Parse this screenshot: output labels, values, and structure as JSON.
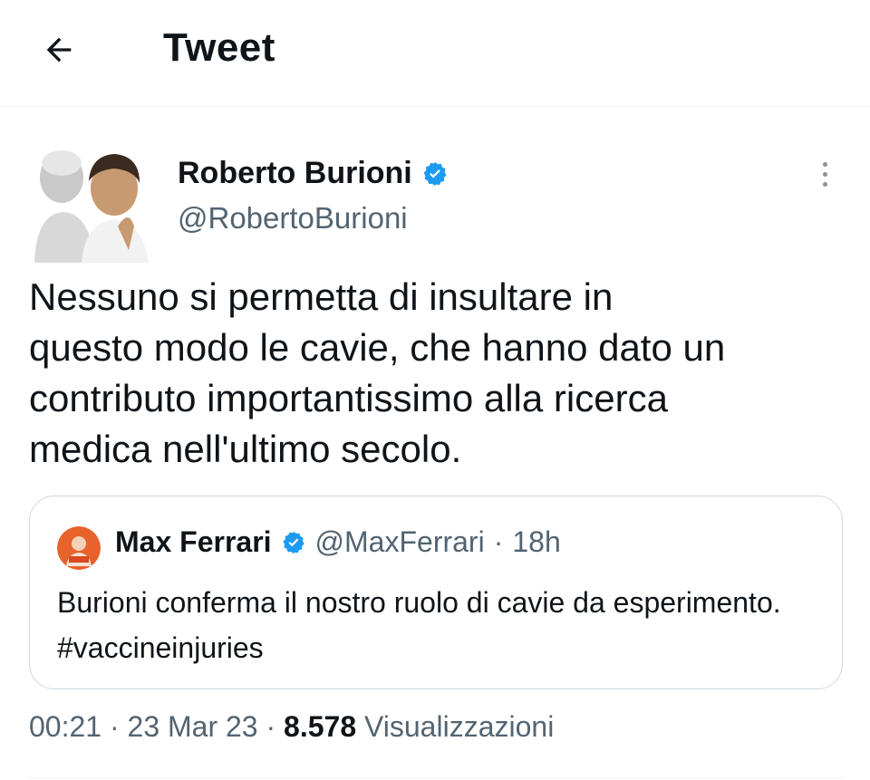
{
  "header": {
    "title": "Tweet",
    "back_icon": "arrow-left-icon"
  },
  "tweet": {
    "author_name": "Roberto Burioni",
    "author_handle": "@RobertoBurioni",
    "verified": true,
    "text": "Nessuno si permetta di insultare in\nquesto modo le cavie, che hanno dato un\ncontributo importantissimo alla ricerca\nmedica nell'ultimo secolo.",
    "more_icon": "more-vertical-icon"
  },
  "quoted_tweet": {
    "author_name": "Max Ferrari",
    "author_handle": "@MaxFerrari",
    "separator": "·",
    "time": "18h",
    "verified": true,
    "text": "Burioni conferma il nostro ruolo di cavie da esperimento. #vaccineinjuries"
  },
  "meta": {
    "time": "00:21",
    "sep1": "·",
    "date": "23 Mar 23",
    "sep2": "·",
    "views_count": "8.578",
    "views_label": "Visualizzazioni"
  },
  "colors": {
    "verified_blue": "#1d9bf0",
    "secondary_text": "#536471",
    "primary_text": "#0f1419"
  }
}
